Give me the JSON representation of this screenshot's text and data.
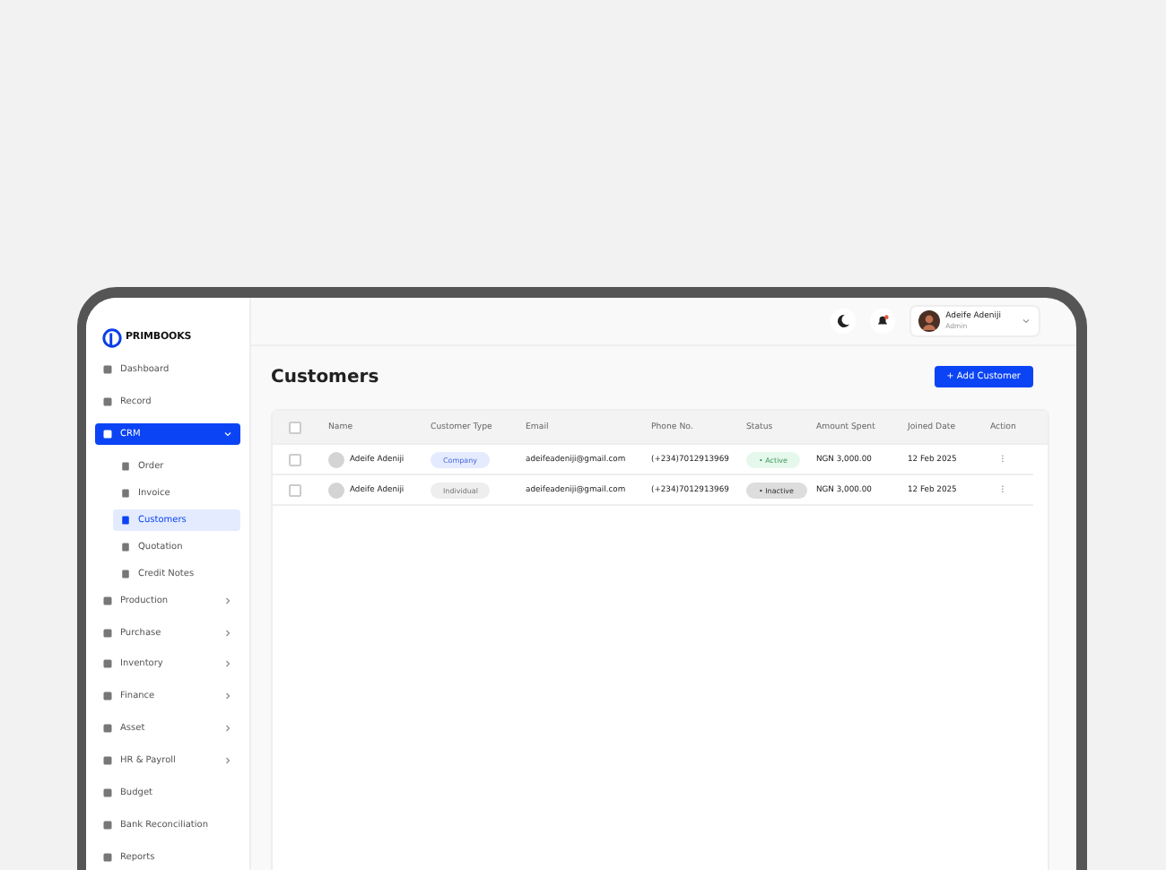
{
  "brand": {
    "name": "PRIMBOOKS"
  },
  "sidebar": {
    "items": [
      {
        "label": "Dashboard",
        "selected": false
      },
      {
        "label": "Record",
        "selected": false
      },
      {
        "label": "CRM",
        "selected": true,
        "expanded": true,
        "children": [
          {
            "label": "Order",
            "selected": false
          },
          {
            "label": "Invoice",
            "selected": false
          },
          {
            "label": "Customers",
            "selected": true
          },
          {
            "label": "Quotation",
            "selected": false
          },
          {
            "label": "Credit Notes",
            "selected": false
          }
        ]
      },
      {
        "label": "Production",
        "selected": false,
        "expanded": false
      },
      {
        "label": "Purchase",
        "selected": false,
        "expanded": false
      },
      {
        "label": "Inventory",
        "selected": false,
        "expanded": false
      },
      {
        "label": "Finance",
        "selected": false,
        "expanded": false
      },
      {
        "label": "Asset",
        "selected": false,
        "expanded": false
      },
      {
        "label": "HR & Payroll",
        "selected": false,
        "expanded": false
      },
      {
        "label": "Budget",
        "selected": false
      },
      {
        "label": "Bank Reconciliation",
        "selected": false
      },
      {
        "label": "Reports",
        "selected": false
      }
    ]
  },
  "user": {
    "name": "Adeife Adeniji",
    "role": "Admin"
  },
  "page": {
    "title": "Customers",
    "add_button": "+ Add Customer"
  },
  "table": {
    "all_checked": false,
    "columns": [
      "Name",
      "Customer Type",
      "Email",
      "Phone No.",
      "Status",
      "Amount Spent",
      "Joined Date",
      "Action"
    ],
    "rows": [
      {
        "checked": false,
        "name": "Adeife Adeniji",
        "customer_type": {
          "kind": "company",
          "label": "Company"
        },
        "email": "adeifeadeniji@gmail.com",
        "phone": "(+234)7012913969",
        "status": {
          "kind": "active",
          "label": "• Active"
        },
        "amount": "NGN 3,000.00",
        "joined": "12 Feb 2025",
        "action": "⋮"
      },
      {
        "checked": false,
        "name": "Adeife Adeniji",
        "customer_type": {
          "kind": "individual",
          "label": "Individual"
        },
        "email": "adeifeadeniji@gmail.com",
        "phone": "(+234)7012913969",
        "status": {
          "kind": "inactive",
          "label": "• Inactive"
        },
        "amount": "NGN 3,000.00",
        "joined": "12 Feb 2025",
        "action": "⋮"
      }
    ]
  }
}
